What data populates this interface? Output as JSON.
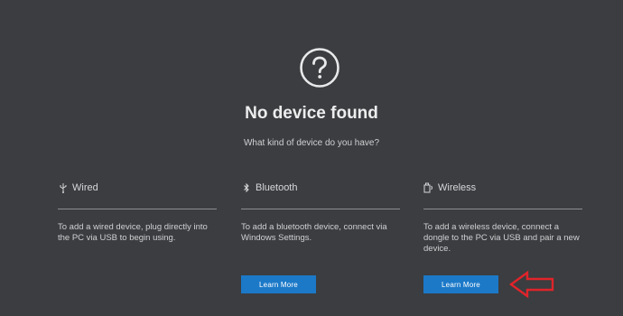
{
  "header": {
    "title": "No device found",
    "subtitle": "What kind of device do you have?"
  },
  "options": [
    {
      "label": "Wired",
      "icon": "usb-icon",
      "description": "To add a wired device, plug directly into the PC via USB to begin using."
    },
    {
      "label": "Bluetooth",
      "icon": "bluetooth-icon",
      "description": "To add a bluetooth device, connect via Windows Settings.",
      "button_label": "Learn More"
    },
    {
      "label": "Wireless",
      "icon": "dongle-icon",
      "description": "To add a wireless device, connect a dongle to the PC via USB and pair a new device.",
      "button_label": "Learn More"
    }
  ],
  "colors": {
    "background": "#3b3d40",
    "button": "#1c79c8",
    "annotation_arrow": "#e0242a"
  }
}
